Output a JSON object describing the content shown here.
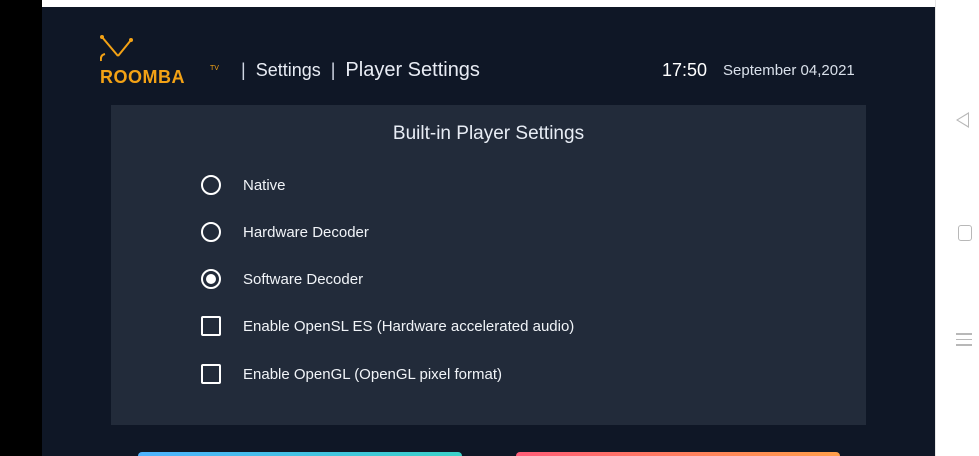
{
  "header": {
    "logo_text": "ROOMBA",
    "logo_suffix": "TV",
    "sep1": "|",
    "breadcrumb_settings": "Settings",
    "sep2": "|",
    "page_title": "Player Settings",
    "time": "17:50",
    "date": "September 04,2021"
  },
  "panel": {
    "title": "Built-in Player Settings",
    "options": [
      {
        "type": "radio",
        "label": "Native",
        "checked": false
      },
      {
        "type": "radio",
        "label": "Hardware Decoder",
        "checked": false
      },
      {
        "type": "radio",
        "label": "Software Decoder",
        "checked": true
      },
      {
        "type": "checkbox",
        "label": "Enable OpenSL ES (Hardware accelerated audio)",
        "checked": false
      },
      {
        "type": "checkbox",
        "label": "Enable OpenGL (OpenGL pixel format)",
        "checked": false
      }
    ]
  },
  "icons": {
    "back": "triangle-back-icon",
    "home": "square-home-icon",
    "menu": "menu-lines-icon",
    "logo": "tv-antenna-logo-icon"
  },
  "colors": {
    "screen_bg": "#0f1726",
    "panel_bg": "#222b3a",
    "logo_orange": "#f3a215"
  }
}
